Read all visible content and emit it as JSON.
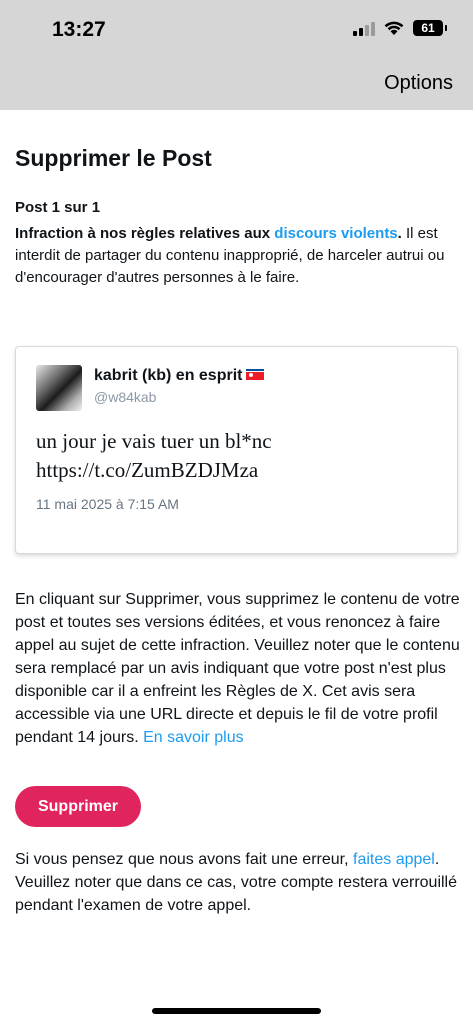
{
  "status_bar": {
    "time": "13:27",
    "battery": "61",
    "icons": [
      "signal-icon",
      "wifi-icon",
      "battery-icon"
    ]
  },
  "header": {
    "options_label": "Options"
  },
  "page": {
    "title": "Supprimer le Post",
    "post_count": "Post 1 sur 1",
    "rule_prefix": "Infraction à nos règles relatives aux ",
    "rule_link": "discours violents",
    "rule_suffix": ".",
    "rule_description": "Il est interdit de partager du contenu inapproprié, de harceler autrui ou d'encourager d'autres personnes à le faire."
  },
  "tweet": {
    "display_name": "kabrit (kb) en esprit",
    "flag_icon": "north-korea-flag-icon",
    "handle": "@w84kab",
    "text_line1": "un jour je vais tuer un bl*nc",
    "text_line2": "https://t.co/ZumBZDJMza",
    "date": "11 mai 2025 à 7:15 AM"
  },
  "explanation": {
    "text": "En cliquant sur Supprimer, vous supprimez le contenu de votre post et toutes ses versions éditées, et vous renoncez à faire appel au sujet de cette infraction. Veuillez noter que le contenu sera remplacé par un avis indiquant que votre post n'est plus disponible car il a enfreint les Règles de X. Cet avis sera accessible via une URL directe et depuis le fil de votre profil pendant 14 jours. ",
    "link": "En savoir plus"
  },
  "actions": {
    "delete_label": "Supprimer"
  },
  "appeal": {
    "prefix": "Si vous pensez que nous avons fait une erreur, ",
    "link": "faites appel",
    "suffix": ". Veuillez noter que dans ce cas, votre compte restera verrouillé pendant l'examen de votre appel."
  },
  "colors": {
    "accent_link": "#1d9bf0",
    "delete_button": "#e0245e",
    "topbar_bg": "#d6d6d6"
  }
}
